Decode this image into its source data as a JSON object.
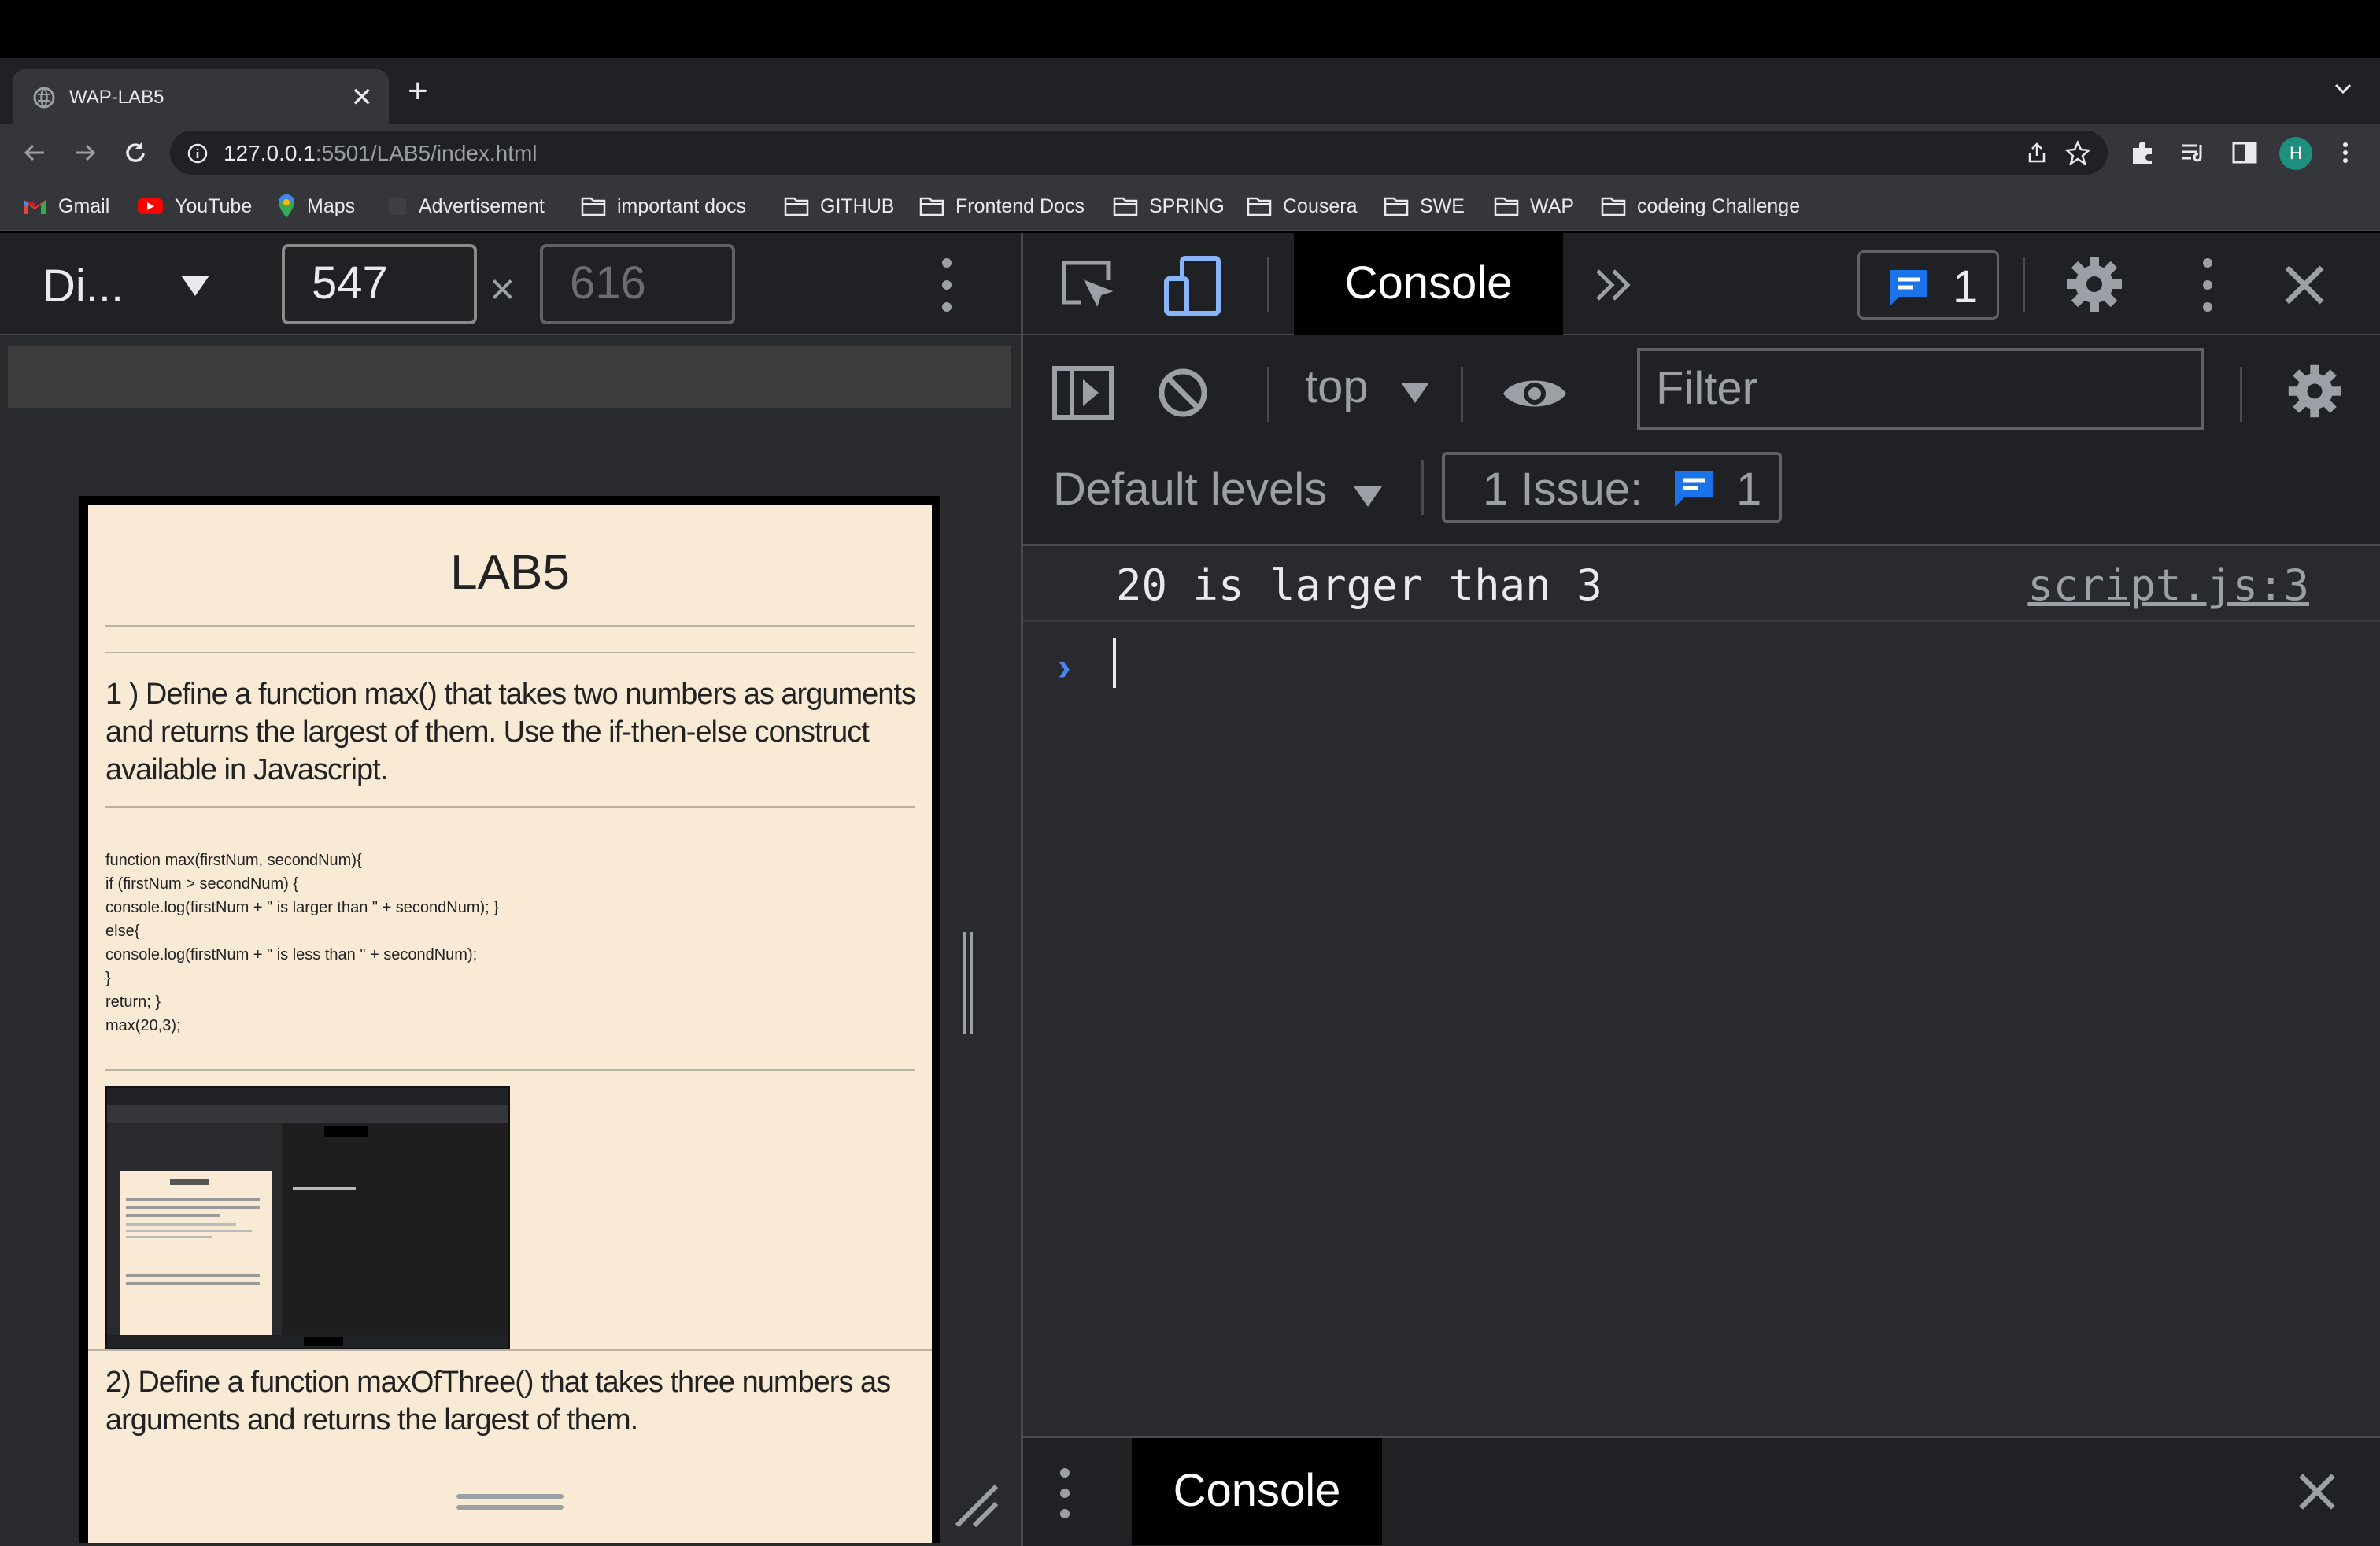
{
  "browser": {
    "tab_title": "WAP-LAB5",
    "url_host": "127.0.0.1",
    "url_path": ":5501/LAB5/index.html",
    "bookmarks": [
      "Gmail",
      "YouTube",
      "Maps",
      "Advertisement",
      "important docs",
      "GITHUB",
      "Frontend Docs",
      "SPRING",
      "Cousera",
      "SWE",
      "WAP",
      "codeing Challenge"
    ],
    "avatar": "H"
  },
  "device_toolbar": {
    "device": "Di...",
    "width": "547",
    "height": "616",
    "times": "×"
  },
  "page": {
    "title": "LAB5",
    "q1": "1 ) Define a function max() that takes two numbers as arguments and returns the largest of them. Use the if-then-else construct available in Javascript.",
    "code": [
      "function max(firstNum, secondNum){",
      "if (firstNum > secondNum) {",
      "console.log(firstNum + \" is larger than \" + secondNum); }",
      "else{",
      "console.log(firstNum + \" is less than \" + secondNum);",
      "}",
      "return; }",
      "max(20,3);"
    ],
    "q2": "2) Define a function maxOfThree() that takes three numbers as arguments and returns the largest of them."
  },
  "devtools": {
    "active_tab": "Console",
    "issue_count": "1",
    "context": "top",
    "filter_placeholder": "Filter",
    "levels": "Default levels",
    "issues_label": "1 Issue:",
    "issues_count": "1",
    "console_message": "20 is larger than 3",
    "console_source": "script.js:3",
    "drawer_tab": "Console"
  },
  "colors": {
    "accent": "#4a86f0",
    "page_bg": "#f8ead5"
  }
}
